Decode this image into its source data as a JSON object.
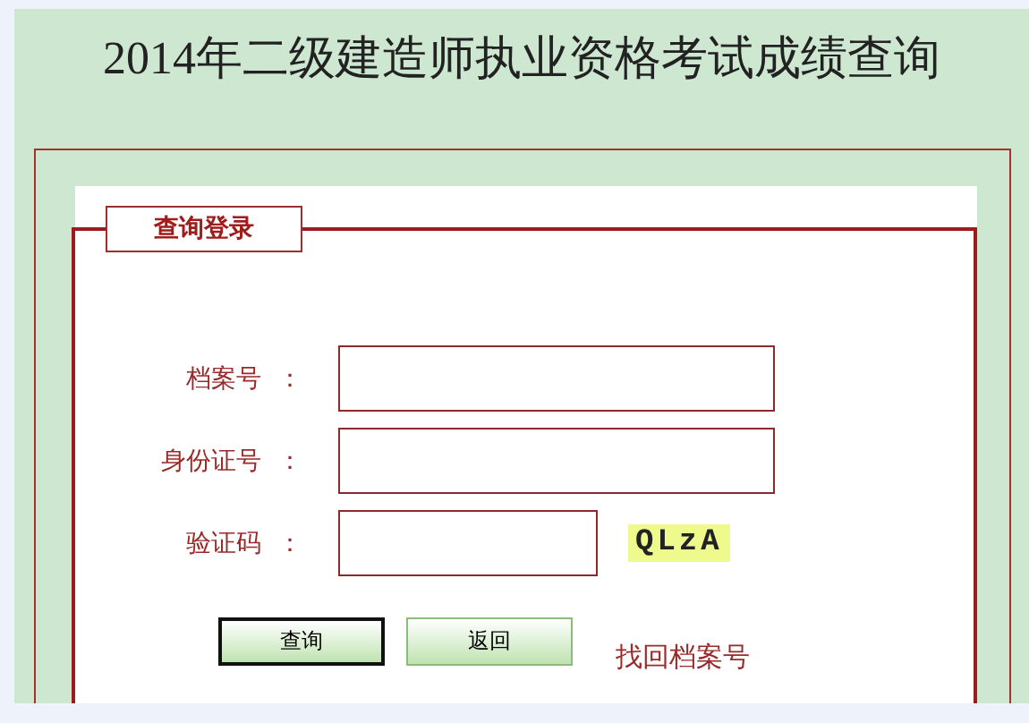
{
  "title": "2014年二级建造师执业资格考试成绩查询",
  "login": {
    "legend": "查询登录",
    "fields": [
      {
        "label": "档案号",
        "colon": "：",
        "kind": "text"
      },
      {
        "label": "身份证号",
        "colon": "：",
        "kind": "text"
      },
      {
        "label": "验证码",
        "colon": "：",
        "kind": "captcha",
        "captcha": "QLzA"
      }
    ],
    "buttons": [
      {
        "label": "查询",
        "default": true
      },
      {
        "label": "返回",
        "default": false
      }
    ],
    "link": "找回档案号"
  }
}
